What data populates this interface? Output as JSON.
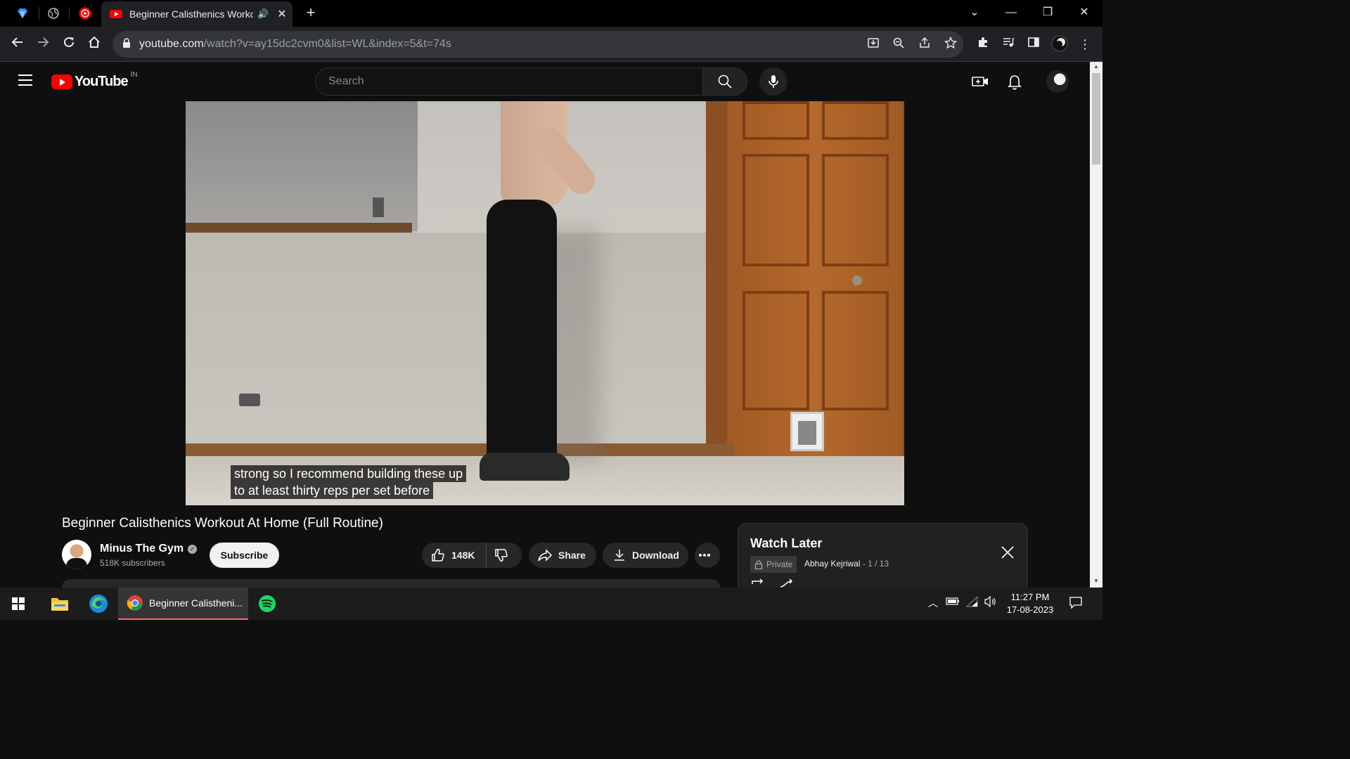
{
  "browser": {
    "active_tab_title": "Beginner Calisthenics Workout",
    "url_host": "youtube.com",
    "url_path": "/watch?v=ay15dc2cvm0&list=WL&index=5&t=74s"
  },
  "youtube": {
    "logo_text": "YouTube",
    "country_code": "IN",
    "search_placeholder": "Search"
  },
  "video": {
    "caption_line1": "strong so I recommend building these up",
    "caption_line2": "to at least thirty reps per set before",
    "title": "Beginner Calisthenics Workout At Home (Full Routine)"
  },
  "channel": {
    "name": "Minus The Gym",
    "subscribers": "518K subscribers",
    "subscribe_label": "Subscribe"
  },
  "actions": {
    "likes": "148K",
    "share_label": "Share",
    "download_label": "Download"
  },
  "playlist": {
    "title": "Watch Later",
    "privacy": "Private",
    "owner": "Abhay Kejriwal",
    "position": "1 / 13"
  },
  "taskbar": {
    "chrome_label": "Beginner Calistheni...",
    "time": "11:27 PM",
    "date": "17-08-2023"
  },
  "colors": {
    "youtube_red": "#ff0000",
    "background": "#0f0f0f",
    "browser_chrome": "#202124"
  }
}
